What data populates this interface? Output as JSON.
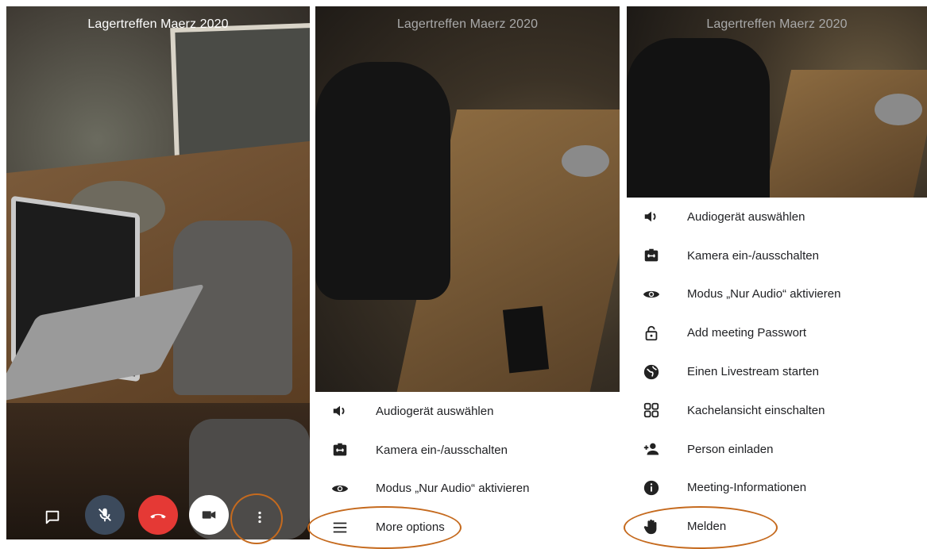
{
  "panels": [
    {
      "title": "Lagertreffen Maerz 2020"
    },
    {
      "title": "Lagertreffen Maerz 2020"
    },
    {
      "title": "Lagertreffen Maerz 2020"
    }
  ],
  "controls": {
    "chat_icon": "chat-icon",
    "mute_icon": "mic-off-icon",
    "hangup_icon": "phone-hangup-icon",
    "video_icon": "videocam-icon",
    "more_icon": "more-vertical-icon",
    "colors": {
      "mute_bg": "#3c4a5c",
      "hangup_bg": "#e53935",
      "video_bg": "#ffffff"
    }
  },
  "menu_short": {
    "items": [
      {
        "icon": "speaker-icon",
        "label": "Audiogerät auswählen"
      },
      {
        "icon": "camera-switch-icon",
        "label": "Kamera ein-/ausschalten"
      },
      {
        "icon": "eye-icon",
        "label": "Modus „Nur Audio“ aktivieren"
      },
      {
        "icon": "menu-icon",
        "label": "More options"
      }
    ]
  },
  "menu_full": {
    "items": [
      {
        "icon": "speaker-icon",
        "label": "Audiogerät auswählen"
      },
      {
        "icon": "camera-switch-icon",
        "label": "Kamera ein-/ausschalten"
      },
      {
        "icon": "eye-icon",
        "label": "Modus „Nur Audio“ aktivieren"
      },
      {
        "icon": "lock-open-icon",
        "label": "Add meeting Passwort"
      },
      {
        "icon": "globe-icon",
        "label": "Einen Livestream starten"
      },
      {
        "icon": "tile-view-icon",
        "label": "Kachelansicht einschalten"
      },
      {
        "icon": "person-add-icon",
        "label": "Person einladen"
      },
      {
        "icon": "info-icon",
        "label": "Meeting-Informationen"
      },
      {
        "icon": "hand-icon",
        "label": "Melden"
      }
    ]
  },
  "annotation_color": "#c56a1e"
}
